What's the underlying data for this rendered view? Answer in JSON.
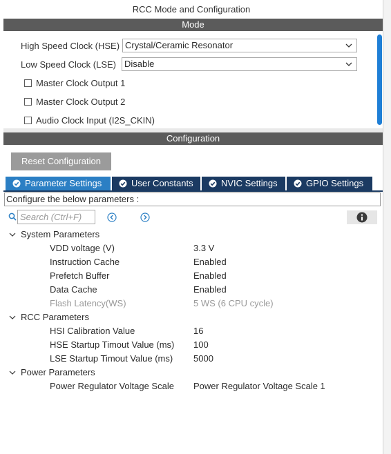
{
  "window": {
    "title": "RCC Mode and Configuration"
  },
  "mode": {
    "header": "Mode",
    "hse": {
      "label": "High Speed Clock (HSE)",
      "value": "Crystal/Ceramic Resonator"
    },
    "lse": {
      "label": "Low Speed Clock (LSE)",
      "value": "Disable"
    },
    "checkboxes": [
      {
        "label": "Master Clock Output 1",
        "checked": false
      },
      {
        "label": "Master Clock Output 2",
        "checked": false
      },
      {
        "label": "Audio Clock Input (I2S_CKIN)",
        "checked": false
      }
    ]
  },
  "configuration": {
    "header": "Configuration",
    "reset_label": "Reset Configuration",
    "tabs": [
      {
        "label": "Parameter Settings",
        "active": true
      },
      {
        "label": "User Constants",
        "active": false
      },
      {
        "label": "NVIC Settings",
        "active": false
      },
      {
        "label": "GPIO Settings",
        "active": false
      }
    ],
    "description": "Configure the below parameters :",
    "search_placeholder": "Search (Ctrl+F)",
    "groups": [
      {
        "name": "System Parameters",
        "params": [
          {
            "name": "VDD voltage (V)",
            "value": "3.3 V",
            "disabled": false
          },
          {
            "name": "Instruction Cache",
            "value": "Enabled",
            "disabled": false
          },
          {
            "name": "Prefetch Buffer",
            "value": "Enabled",
            "disabled": false
          },
          {
            "name": "Data Cache",
            "value": "Enabled",
            "disabled": false
          },
          {
            "name": "Flash Latency(WS)",
            "value": "5 WS (6 CPU cycle)",
            "disabled": true
          }
        ]
      },
      {
        "name": "RCC Parameters",
        "params": [
          {
            "name": "HSI Calibration Value",
            "value": "16",
            "disabled": false
          },
          {
            "name": "HSE Startup Timout Value (ms)",
            "value": "100",
            "disabled": false
          },
          {
            "name": "LSE Startup Timout Value (ms)",
            "value": "5000",
            "disabled": false
          }
        ]
      },
      {
        "name": "Power Parameters",
        "params": [
          {
            "name": "Power Regulator Voltage Scale",
            "value": "Power Regulator Voltage Scale 1",
            "disabled": false
          }
        ]
      }
    ]
  },
  "colors": {
    "section_bar": "#5b5b5b",
    "tab_active": "#2b7fc4",
    "tab_inactive": "#1b3a62",
    "scroll_thumb": "#1f7fd6",
    "reset_button": "#9b9b9b"
  }
}
